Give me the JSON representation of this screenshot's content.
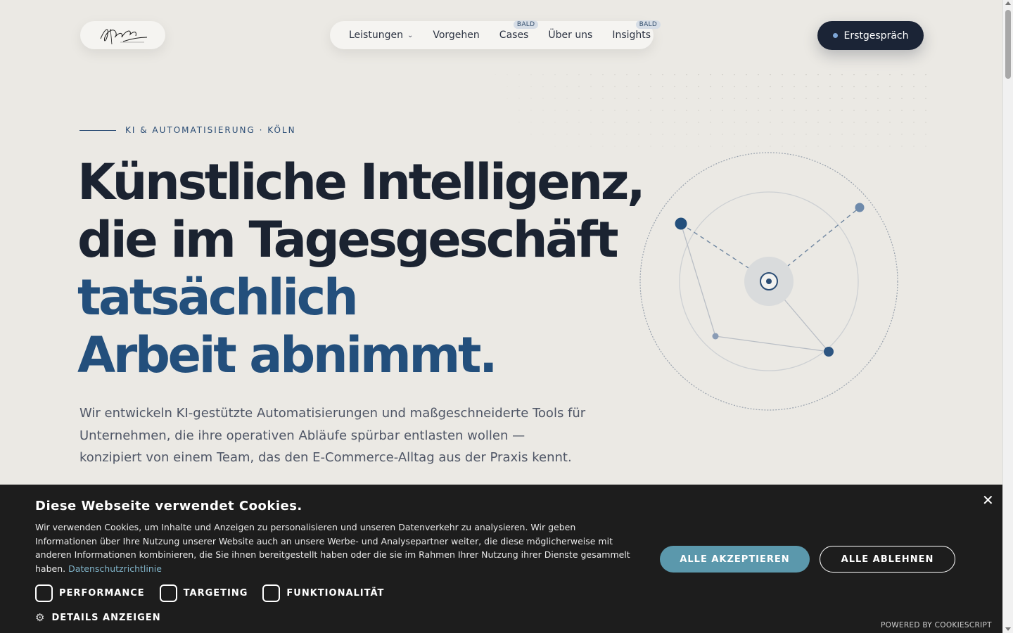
{
  "header": {
    "logo_alt": "Signature logo",
    "nav": [
      {
        "label": "Leistungen",
        "has_dropdown": true,
        "badge": ""
      },
      {
        "label": "Vorgehen",
        "has_dropdown": false,
        "badge": ""
      },
      {
        "label": "Cases",
        "has_dropdown": false,
        "badge": "BALD"
      },
      {
        "label": "Über uns",
        "has_dropdown": false,
        "badge": ""
      },
      {
        "label": "Insights",
        "has_dropdown": false,
        "badge": "BALD"
      }
    ],
    "cta_label": "Erstgespräch"
  },
  "hero": {
    "eyebrow": "KI & AUTOMATISIERUNG · KÖLN",
    "headline_line1": "Künstliche Intelligenz,",
    "headline_line2": "die im Tagesgeschäft",
    "headline_line3": "tatsächlich",
    "headline_line4": "Arbeit abnimmt.",
    "lead": "Wir entwickeln KI-gestützte Automatisierungen und maßgeschneiderte Tools für Unternehmen, die ihre operativen Abläufe spürbar entlasten wollen — konzipiert von einem Team, das den E-Commerce-Alltag aus der Praxis kennt."
  },
  "cookie": {
    "title": "Diese Webseite verwendet Cookies.",
    "text": "Wir verwenden Cookies, um Inhalte und Anzeigen zu personalisieren und unseren Datenverkehr zu analysieren. Wir geben Informationen über Ihre Nutzung unserer Website auch an unsere Werbe- und Analysepartner weiter, die diese möglicherweise mit anderen Informationen kombinieren, die Sie ihnen bereitgestellt haben oder die sie im Rahmen Ihrer Nutzung ihrer Dienste gesammelt haben.",
    "policy_link": "Datenschutzrichtlinie",
    "accept_label": "ALLE AKZEPTIEREN",
    "reject_label": "ALLE ABLEHNEN",
    "checkboxes": [
      {
        "label": "PERFORMANCE",
        "checked": false
      },
      {
        "label": "TARGETING",
        "checked": false
      },
      {
        "label": "FUNKTIONALITÄT",
        "checked": false
      }
    ],
    "details_label": "DETAILS ANZEIGEN",
    "powered_by": "POWERED BY COOKIESCRIPT"
  },
  "colors": {
    "background": "#ebe9e4",
    "ink": "#1b2331",
    "accent_blue": "#234f7c",
    "cookie_bg": "#1d1d1d",
    "accept_button": "#5b98ac"
  }
}
